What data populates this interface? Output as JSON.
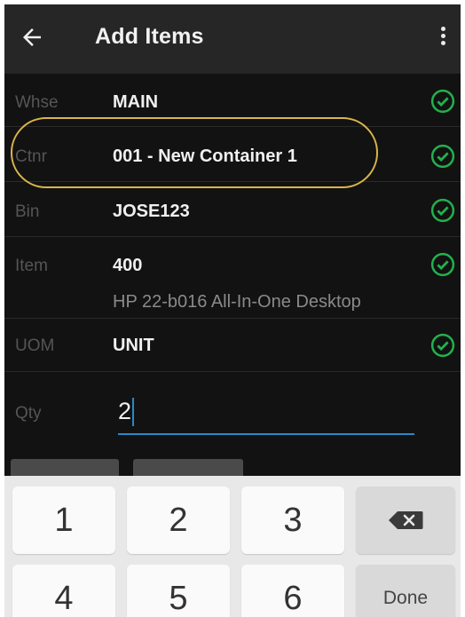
{
  "appbar": {
    "title": "Add Items",
    "back_icon": "arrow-left-icon",
    "menu_icon": "more-vertical-icon"
  },
  "form": {
    "rows": [
      {
        "label": "Whse",
        "value": "MAIN",
        "status": "valid"
      },
      {
        "label": "Ctnr",
        "value": "001 - New Container 1",
        "status": "valid"
      },
      {
        "label": "Bin",
        "value": "JOSE123",
        "status": "valid"
      },
      {
        "label": "Item",
        "value": "400",
        "description": "HP 22-b016 All-In-One Desktop",
        "status": "valid"
      },
      {
        "label": "UOM",
        "value": "UNIT",
        "status": "valid"
      }
    ],
    "qty": {
      "label": "Qty",
      "value": "2"
    }
  },
  "keyboard": {
    "keys": [
      "1",
      "2",
      "3",
      "4",
      "5",
      "6"
    ],
    "done_label": "Done",
    "backspace_icon": "backspace-icon"
  },
  "colors": {
    "check": "#22b14c",
    "highlight": "#d9b54a",
    "accent": "#2b88c8"
  }
}
